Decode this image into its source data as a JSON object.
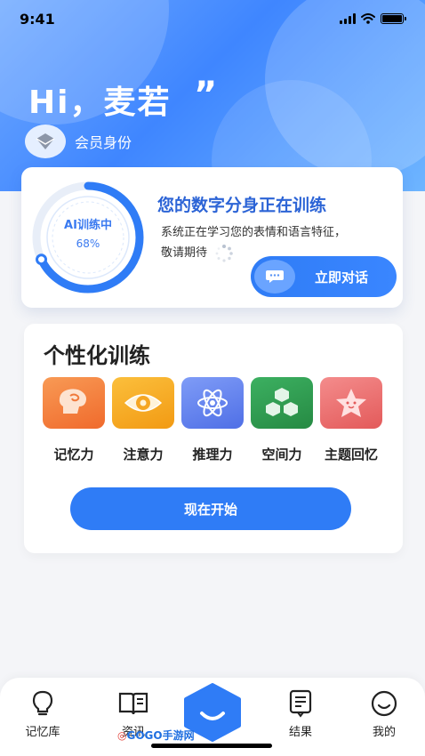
{
  "status_bar": {
    "time": "9:41"
  },
  "header": {
    "greeting": "Hi，麦若",
    "quote": "”",
    "member_label": "会员身份"
  },
  "training_card": {
    "ring_title": "AI训练中",
    "progress_text": "68%",
    "progress": 0.68,
    "title": "您的数字分身正在训练",
    "desc_line1": "系统正在学习您的表情和语言特征，",
    "desc_line2": "敬请期待",
    "chat_button": "立即对话"
  },
  "personal_training": {
    "title": "个性化训练",
    "skills": [
      {
        "label": "记忆力",
        "icon": "brain-icon",
        "color": "#f47a3a"
      },
      {
        "label": "注意力",
        "icon": "eye-icon",
        "color": "#f6a623"
      },
      {
        "label": "推理力",
        "icon": "atom-icon",
        "color": "#5b7ff0"
      },
      {
        "label": "空间力",
        "icon": "cubes-icon",
        "color": "#2f9e4f"
      },
      {
        "label": "主题回忆",
        "icon": "star-icon",
        "color": "#ef6a6a"
      }
    ],
    "start_button": "现在开始"
  },
  "tabbar": {
    "items": [
      {
        "label": "记忆库",
        "icon": "lightbulb-icon"
      },
      {
        "label": "资讯",
        "icon": "book-icon"
      },
      {
        "label": "",
        "icon": "home-smile-icon"
      },
      {
        "label": "结果",
        "icon": "document-icon"
      },
      {
        "label": "我的",
        "icon": "smile-icon"
      }
    ]
  },
  "watermark": {
    "text": "GOGO手游网"
  },
  "colors": {
    "primary": "#2f7cf6",
    "hero_start": "#6fa9ff",
    "hero_end": "#3f86ff"
  }
}
